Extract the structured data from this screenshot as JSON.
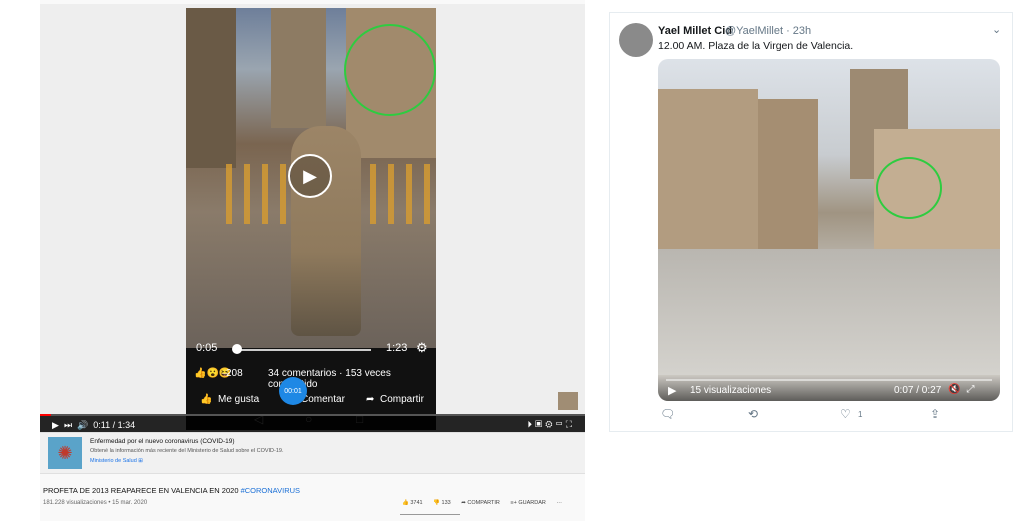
{
  "youtube": {
    "facebook_overlay": {
      "elapsed": "0:05",
      "duration": "1:23",
      "reaction_emojis": "👍😮😆",
      "reaction_count": "208",
      "stats": "34 comentarios · 153 veces compartido",
      "like_label": "Me gusta",
      "comment_label": "Comentar",
      "share_label": "Compartir",
      "time_bubble": "00:01"
    },
    "player": {
      "time_display": "0:11 / 1:34",
      "progress_fraction": 0.02
    },
    "info_card": {
      "title": "Enfermedad por el nuevo coronavirus (COVID-19)",
      "description": "Obtené la información más reciente del Ministerio de Salud sobre el COVID-19.",
      "source": "Ministerio de Salud ⊞"
    },
    "video": {
      "title": "PROFETA DE 2013 REAPARECE EN VALENCIA EN 2020",
      "hashtag": "#CORONAVIRUS",
      "meta": "181.228 visualizaciones • 15 mar. 2020",
      "likes": "👍 3741",
      "dislikes": "👎 133",
      "share": "➦ COMPARTIR",
      "save": "≡+ GUARDAR",
      "more": "···"
    }
  },
  "tweet": {
    "name": "Yael Millet Cid",
    "handle": "@YaelMillet · 23h",
    "text": "12.00 AM. Plaza de la Virgen de Valencia.",
    "video": {
      "views": "15 visualizaciones",
      "time": "0:07 / 0:27"
    },
    "actions": {
      "like_count": "1"
    }
  },
  "colors": {
    "highlight_circle": "#2ecc40",
    "youtube_red": "#ff0000",
    "link_blue": "#1a73e8"
  }
}
